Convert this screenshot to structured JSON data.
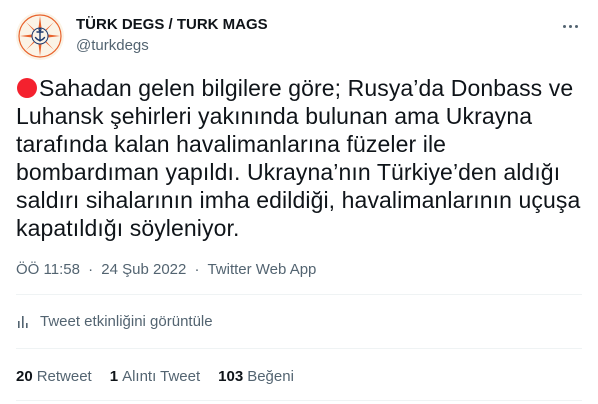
{
  "author": {
    "name": "TÜRK DEGS / TURK MAGS",
    "handle": "@turkdegs"
  },
  "tweet": {
    "text": "Sahadan gelen bilgilere göre; Rusya’da Donbass ve Luhansk şehirleri yakınında bulunan ama Ukrayna tarafında kalan havalimanlarına füzeler ile bombardıman yapıldı. Ukrayna’nın Türkiye’den aldığı saldırı sihalarının imha edildiği, havalimanlarının uçuşa kapatıldığı söyleniyor.",
    "time": "ÖÖ 11:58",
    "date": "24 Şub 2022",
    "source": "Twitter Web App",
    "separator": "·"
  },
  "activity_label": "Tweet etkinliğini görüntüle",
  "stats": {
    "retweets_count": "20",
    "retweets_label": "Retweet",
    "quotes_count": "1",
    "quotes_label": "Alıntı Tweet",
    "likes_count": "103",
    "likes_label": "Beğeni"
  },
  "icons": {
    "avatar": "compass-rose-anchor-logo",
    "live": "red-circle-emoji",
    "more": "more-horizontal-icon",
    "activity": "bar-chart-icon"
  },
  "colors": {
    "text_primary": "#0f1419",
    "text_secondary": "#536471",
    "divider": "#eff3f4",
    "emoji_red": "#f4212e",
    "logo_orange": "#e8622c",
    "logo_navy": "#1d3a6e"
  }
}
